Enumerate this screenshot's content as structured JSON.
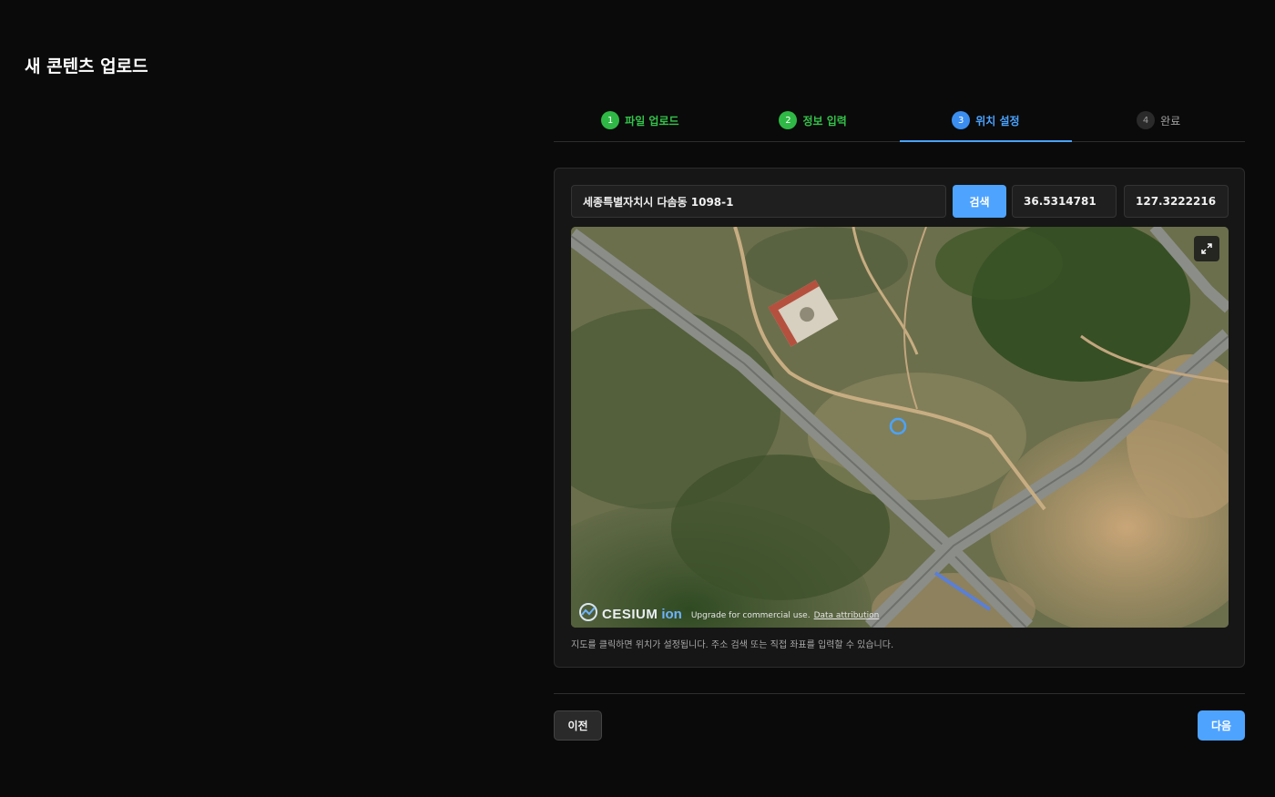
{
  "page": {
    "title": "새 콘텐츠 업로드"
  },
  "stepper": {
    "steps": [
      {
        "number": "1",
        "label": "파일 업로드",
        "state": "done"
      },
      {
        "number": "2",
        "label": "정보 입력",
        "state": "done"
      },
      {
        "number": "3",
        "label": "위치 설정",
        "state": "active"
      },
      {
        "number": "4",
        "label": "완료",
        "state": "pending"
      }
    ]
  },
  "location": {
    "address_value": "세종특별자치시 다솜동 1098-1",
    "search_label": "검색",
    "latitude": "36.5314781",
    "longitude": "127.3222216",
    "hint": "지도를 클릭하면 위치가 설정됩니다. 주소 검색 또는 직접 좌표를 입력할 수 있습니다."
  },
  "map": {
    "logo_text": "CESIUM",
    "logo_suffix": "ion",
    "upgrade_note": "Upgrade for commercial use.",
    "attribution_link": "Data attribution",
    "marker_color": "#4aa3ff"
  },
  "footer": {
    "prev_label": "이전",
    "next_label": "다음"
  },
  "colors": {
    "accent": "#4ea3ff",
    "done": "#34c24a",
    "background": "#0a0a0a"
  }
}
